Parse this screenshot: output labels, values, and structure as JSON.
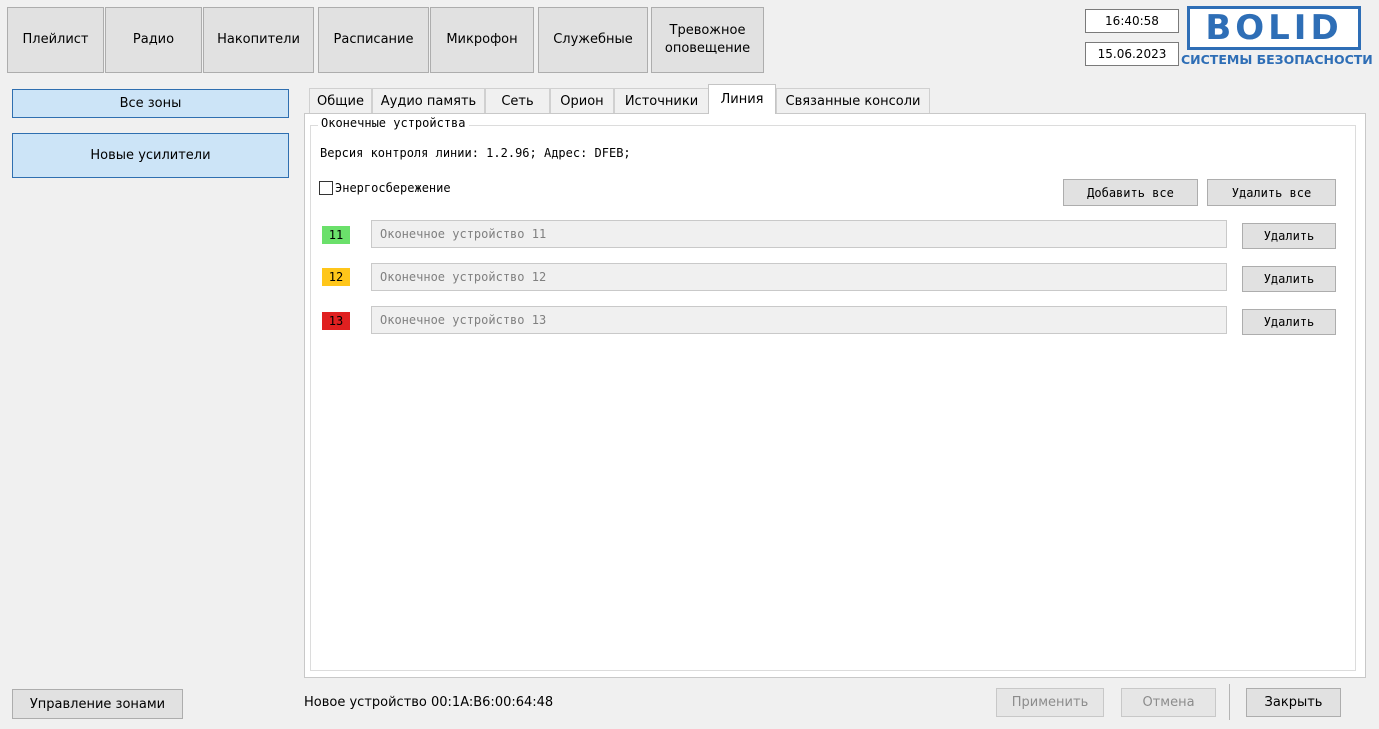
{
  "nav": {
    "playlist": "Плейлист",
    "radio": "Радио",
    "drives": "Накопители",
    "schedule": "Расписание",
    "microphone": "Микрофон",
    "service": "Служебные",
    "alarm": "Тревожное\nоповещение"
  },
  "clock": {
    "time": "16:40:58",
    "date": "15.06.2023"
  },
  "logo": {
    "word": "BOLID",
    "tagline": "СИСТЕМЫ БЕЗОПАСНОСТИ"
  },
  "zones": {
    "all": "Все зоны",
    "new_amplifiers": "Новые усилители",
    "manage": "Управление зонами"
  },
  "tabs": {
    "general": "Общие",
    "audio_memory": "Аудио память",
    "network": "Сеть",
    "orion": "Орион",
    "sources": "Источники",
    "line": "Линия",
    "linked_consoles": "Связанные консоли",
    "active": "line"
  },
  "line": {
    "group_title": "Оконечные устройства",
    "version_info": "Версия контроля линии: 1.2.96; Адрес: DFEB;",
    "energy_saving_label": "Энергосбережение",
    "energy_saving_checked": false,
    "add_all": "Добавить все",
    "delete_all": "Удалить все",
    "devices": [
      {
        "number": "11",
        "name": "Оконечное устройство 11",
        "status_color": "#6be06b",
        "delete": "Удалить"
      },
      {
        "number": "12",
        "name": "Оконечное устройство 12",
        "status_color": "#ffc61a",
        "delete": "Удалить"
      },
      {
        "number": "13",
        "name": "Оконечное устройство 13",
        "status_color": "#e02020",
        "delete": "Удалить"
      }
    ]
  },
  "footer": {
    "status": "Новое устройство 00:1A:B6:00:64:48",
    "apply": "Применить",
    "cancel": "Отмена",
    "close": "Закрыть"
  }
}
